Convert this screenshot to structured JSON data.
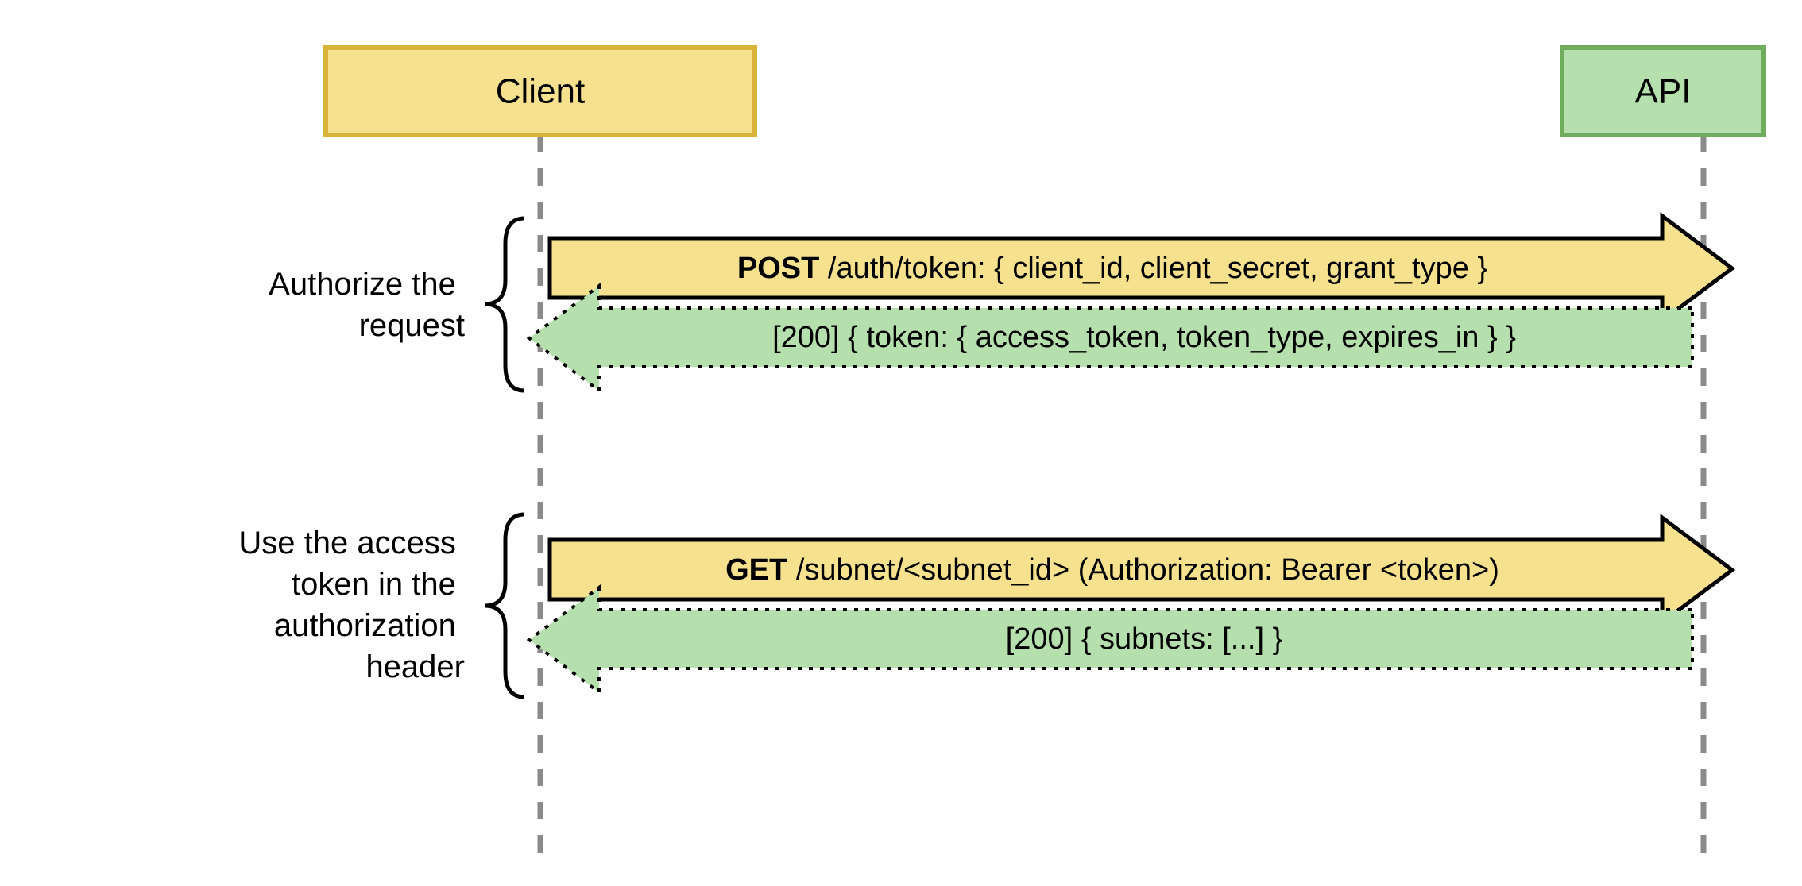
{
  "actors": {
    "client": "Client",
    "api": "API"
  },
  "colors": {
    "clientFill": "#f6e18e",
    "clientStroke": "#d8b53a",
    "apiFill": "#b5dfad",
    "apiStroke": "#6fac5e",
    "lifeline": "#8a8a8a",
    "arrowSolidStroke": "#000000",
    "arrowDottedStroke": "#000000"
  },
  "phases": [
    {
      "labelLines": [
        "Authorize the",
        "request"
      ],
      "request": {
        "method": "POST",
        "text": " /auth/token: { client_id, client_secret, grant_type }"
      },
      "response": {
        "text": "[200] { token: { access_token, token_type, expires_in } }"
      }
    },
    {
      "labelLines": [
        "Use the access",
        "token in the",
        "authorization",
        "header"
      ],
      "request": {
        "method": "GET",
        "text": " /subnet/<subnet_id> (Authorization: Bearer <token>)"
      },
      "response": {
        "text": "[200] { subnets: [...] }"
      }
    }
  ]
}
